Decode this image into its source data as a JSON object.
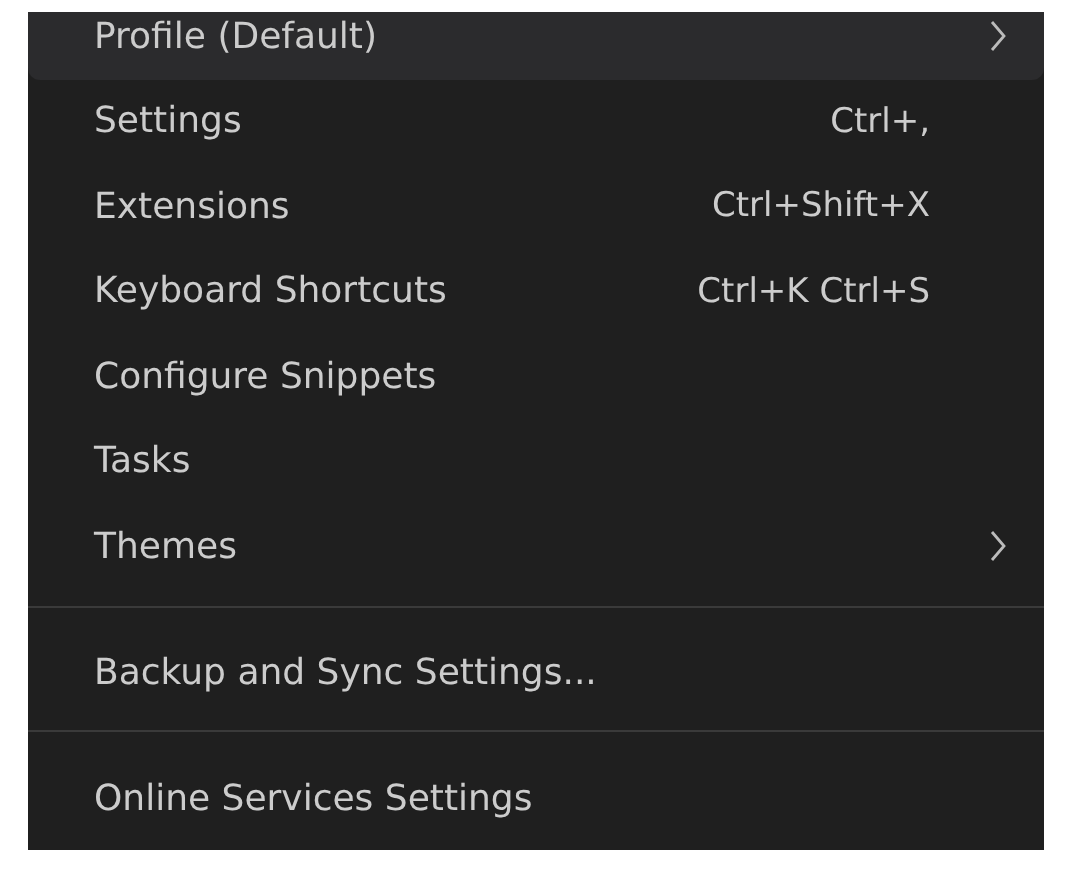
{
  "menu": {
    "groups": [
      {
        "items": [
          {
            "label": "Profile (Default)",
            "selected": true,
            "submenu": true
          },
          {
            "label": "Settings",
            "shortcut": "Ctrl+,",
            "selected": false,
            "submenu": false
          },
          {
            "label": "Extensions",
            "shortcut": "Ctrl+Shift+X",
            "selected": false,
            "submenu": false
          },
          {
            "label": "Keyboard Shortcuts",
            "shortcut": "Ctrl+K Ctrl+S",
            "selected": false,
            "submenu": false
          },
          {
            "label": "Configure Snippets",
            "selected": false,
            "submenu": false
          },
          {
            "label": "Tasks",
            "selected": false,
            "submenu": false
          },
          {
            "label": "Themes",
            "selected": false,
            "submenu": true
          }
        ]
      },
      {
        "items": [
          {
            "label": "Backup and Sync Settings...",
            "selected": false,
            "submenu": false
          }
        ]
      },
      {
        "items": [
          {
            "label": "Online Services Settings",
            "selected": false,
            "submenu": false
          }
        ]
      }
    ]
  }
}
